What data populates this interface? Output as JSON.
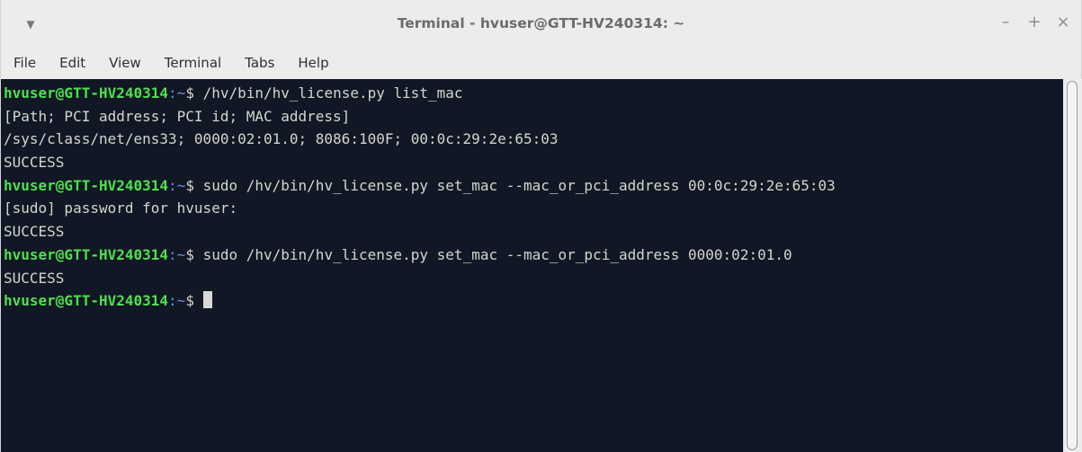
{
  "window": {
    "title": "Terminal - hvuser@GTT-HV240314: ~",
    "menu_icon": "chevron-down-icon",
    "controls": {
      "minimize": "–",
      "maximize": "+",
      "close": "×"
    }
  },
  "menubar": {
    "items": [
      "File",
      "Edit",
      "View",
      "Terminal",
      "Tabs",
      "Help"
    ]
  },
  "terminal": {
    "colors": {
      "background": "#111724",
      "text": "#d3d7cf",
      "user": "#4ee04e",
      "path": "#6b8fd8"
    },
    "prompt": {
      "user_host": "hvuser@GTT-HV240314",
      "colon": ":",
      "path": "~",
      "symbol": "$ "
    },
    "lines": [
      {
        "type": "prompt",
        "cmd": "/hv/bin/hv_license.py list_mac"
      },
      {
        "type": "output",
        "text": "[Path; PCI address; PCI id; MAC address]"
      },
      {
        "type": "output",
        "text": "/sys/class/net/ens33; 0000:02:01.0; 8086:100F; 00:0c:29:2e:65:03"
      },
      {
        "type": "output",
        "text": "SUCCESS"
      },
      {
        "type": "prompt",
        "cmd": "sudo /hv/bin/hv_license.py set_mac --mac_or_pci_address 00:0c:29:2e:65:03"
      },
      {
        "type": "output",
        "text": "[sudo] password for hvuser:"
      },
      {
        "type": "output",
        "text": "SUCCESS"
      },
      {
        "type": "prompt",
        "cmd": "sudo /hv/bin/hv_license.py set_mac --mac_or_pci_address 0000:02:01.0"
      },
      {
        "type": "output",
        "text": "SUCCESS"
      },
      {
        "type": "prompt",
        "cmd": "",
        "cursor": true
      }
    ]
  }
}
